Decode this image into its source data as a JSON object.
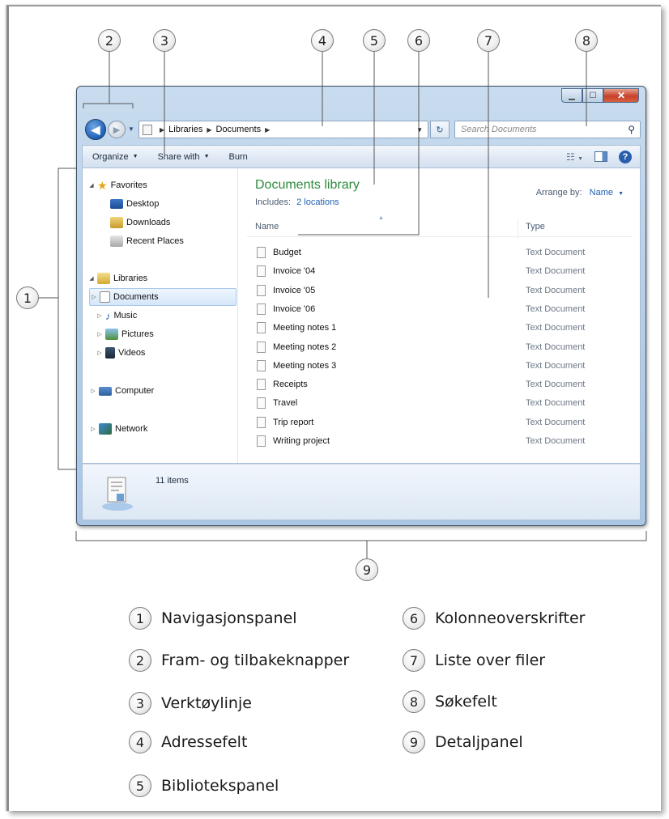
{
  "window": {
    "address": {
      "segments": [
        "Libraries",
        "Documents"
      ]
    },
    "search": {
      "placeholder": "Search Documents"
    },
    "toolbar": {
      "organize": "Organize",
      "share_with": "Share with",
      "burn": "Burn"
    },
    "nav_pane": {
      "items": [
        {
          "label": "Favorites",
          "icon": "star-icon"
        },
        {
          "label": "Desktop",
          "icon": "desktop-icon"
        },
        {
          "label": "Downloads",
          "icon": "downloads-icon"
        },
        {
          "label": "Recent Places",
          "icon": "recent-places-icon"
        },
        {
          "label": "Libraries",
          "icon": "libraries-icon"
        },
        {
          "label": "Documents",
          "icon": "documents-icon",
          "selected": true
        },
        {
          "label": "Music",
          "icon": "music-icon"
        },
        {
          "label": "Pictures",
          "icon": "pictures-icon"
        },
        {
          "label": "Videos",
          "icon": "videos-icon"
        },
        {
          "label": "Computer",
          "icon": "computer-icon"
        },
        {
          "label": "Network",
          "icon": "network-icon"
        }
      ]
    },
    "library": {
      "title": "Documents library",
      "includes_label": "Includes:",
      "includes_link": "2 locations",
      "arrange_label": "Arrange by:",
      "arrange_value": "Name"
    },
    "columns": {
      "name": "Name",
      "type": "Type"
    },
    "files": [
      {
        "name": "Budget",
        "type": "Text Document"
      },
      {
        "name": "Invoice '04",
        "type": "Text Document"
      },
      {
        "name": "Invoice '05",
        "type": "Text Document"
      },
      {
        "name": "Invoice '06",
        "type": "Text Document"
      },
      {
        "name": "Meeting notes 1",
        "type": "Text Document"
      },
      {
        "name": "Meeting notes 2",
        "type": "Text Document"
      },
      {
        "name": "Meeting notes 3",
        "type": "Text Document"
      },
      {
        "name": "Receipts",
        "type": "Text Document"
      },
      {
        "name": "Travel",
        "type": "Text Document"
      },
      {
        "name": "Trip report",
        "type": "Text Document"
      },
      {
        "name": "Writing project",
        "type": "Text Document"
      }
    ],
    "details": {
      "count": "11 items"
    }
  },
  "callouts": [
    "1",
    "2",
    "3",
    "4",
    "5",
    "6",
    "7",
    "8",
    "9"
  ],
  "legend": [
    {
      "num": "1",
      "text": "Navigasjonspanel"
    },
    {
      "num": "2",
      "text": "Fram- og tilbakeknapper"
    },
    {
      "num": "3",
      "text": "Verktøylinje"
    },
    {
      "num": "4",
      "text": "Adressefelt"
    },
    {
      "num": "5",
      "text": "Bibliotekspanel"
    },
    {
      "num": "6",
      "text": "Kolonneoverskrifter"
    },
    {
      "num": "7",
      "text": "Liste over filer"
    },
    {
      "num": "8",
      "text": "Søkefelt"
    },
    {
      "num": "9",
      "text": "Detaljpanel"
    }
  ],
  "colors": {
    "library_title": "#2e8b3c",
    "link": "#1f5fb4",
    "window_frame": "#b7cfe8"
  }
}
